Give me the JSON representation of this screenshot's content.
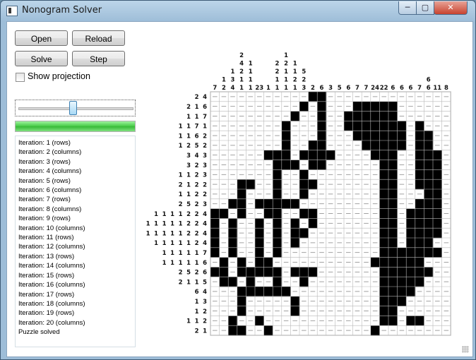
{
  "window": {
    "title": "Nonogram Solver",
    "close_glyph": "✕",
    "max_glyph": "▢",
    "min_glyph": "─"
  },
  "controls": {
    "open": "Open",
    "reload": "Reload",
    "solve": "Solve",
    "step": "Step",
    "show_projection": "Show projection",
    "show_projection_checked": false,
    "slider_fraction": 0.47,
    "progress_fraction": 1.0
  },
  "log": [
    "Iteration: 1 (rows)",
    "Iteration: 2 (columns)",
    "Iteration: 3 (rows)",
    "Iteration: 4 (columns)",
    "Iteration: 5 (rows)",
    "Iteration: 6 (columns)",
    "Iteration: 7 (rows)",
    "Iteration: 8 (columns)",
    "Iteration: 9 (rows)",
    "Iteration: 10 (columns)",
    "Iteration: 11 (rows)",
    "Iteration: 12 (columns)",
    "Iteration: 13 (rows)",
    "Iteration: 14 (columns)",
    "Iteration: 15 (rows)",
    "Iteration: 16 (columns)",
    "Iteration: 17 (rows)",
    "Iteration: 18 (columns)",
    "Iteration: 19 (rows)",
    "Iteration: 20 (columns)",
    "Puzzle solved"
  ],
  "puzzle": {
    "column_clues": [
      [
        "7"
      ],
      [
        "1",
        "2"
      ],
      [
        "1",
        "3",
        "4"
      ],
      [
        "2",
        "4",
        "2",
        "1",
        "1"
      ],
      [
        "1",
        "1",
        "1",
        "1"
      ],
      [
        "23"
      ],
      [
        "1"
      ],
      [
        "2",
        "2",
        "1",
        "1"
      ],
      [
        "1",
        "2",
        "1",
        "1",
        "1"
      ],
      [
        "1",
        "1",
        "2",
        "1"
      ],
      [
        "5",
        "2",
        "3"
      ],
      [
        "2"
      ],
      [
        "6"
      ],
      [
        "3"
      ],
      [
        "5"
      ],
      [
        "6"
      ],
      [
        "7"
      ],
      [
        "7"
      ],
      [
        "24"
      ],
      [
        "22"
      ],
      [
        "6"
      ],
      [
        "6"
      ],
      [
        "6"
      ],
      [
        "7"
      ],
      [
        "6",
        "6"
      ],
      [
        "11"
      ],
      [
        "8"
      ]
    ],
    "row_clues": [
      [
        "2",
        "4"
      ],
      [
        "2",
        "1",
        "6"
      ],
      [
        "1",
        "1",
        "7"
      ],
      [
        "1",
        "1",
        "7",
        "1"
      ],
      [
        "1",
        "1",
        "6",
        "2"
      ],
      [
        "1",
        "2",
        "5",
        "2"
      ],
      [
        "3",
        "4",
        "3"
      ],
      [
        "3",
        "2",
        "3"
      ],
      [
        "1",
        "1",
        "2",
        "3"
      ],
      [
        "2",
        "1",
        "2",
        "2"
      ],
      [
        "1",
        "1",
        "2",
        "2"
      ],
      [
        "2",
        "5",
        "2",
        "3"
      ],
      [
        "1",
        "1",
        "1",
        "1",
        "2",
        "2",
        "4"
      ],
      [
        "1",
        "1",
        "1",
        "1",
        "1",
        "2",
        "2",
        "4"
      ],
      [
        "1",
        "1",
        "1",
        "1",
        "1",
        "2",
        "2",
        "4"
      ],
      [
        "1",
        "1",
        "1",
        "1",
        "1",
        "2",
        "4"
      ],
      [
        "1",
        "1",
        "1",
        "1",
        "1",
        "7"
      ],
      [
        "1",
        "1",
        "1",
        "1",
        "1",
        "6"
      ],
      [
        "2",
        "5",
        "2",
        "6"
      ],
      [
        "2",
        "1",
        "1",
        "5"
      ],
      [
        "6",
        "4"
      ],
      [
        "1",
        "3"
      ],
      [
        "1",
        "2"
      ],
      [
        "1",
        "1",
        "2"
      ],
      [
        "2",
        "1"
      ]
    ],
    "solution": [
      "...........##..............",
      "..........#.#...#####......",
      ".........#..#..######......",
      "........#...#..#######.#...",
      "........#...#...######.##..",
      "........#..##....#####.##..",
      "......###.####....###..###.",
      ".......###.##......##..###.",
      ".......#..#........##..###.",
      "...##..#..##.......##..###.",
      "...#...#..#........##...##.",
      "..##.#####.........##..###.",
      "##.#..##..##.......##.####.",
      "#.#..#.#.#.#.......##.####.",
      "#.#..#.#.##........##.####.",
      "#.#..#.#.#.........##.###..",
      "#.#..#.#...........#######.",
      ".#.#.##...........######...",
      "##.#####.###.......######..",
      ".##.#..#..#........#####...",
      "...######..........####....",
      "...#.....#.........###.....",
      "...#.....#.........##......",
      "..#..#.............##.##...",
      "..##..#...........#........"
    ]
  }
}
